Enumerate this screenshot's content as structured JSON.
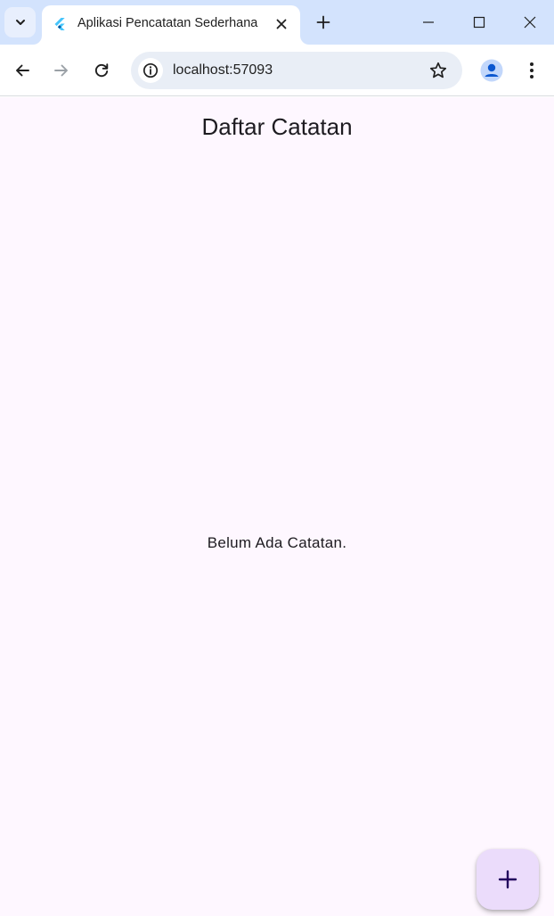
{
  "browser": {
    "tab": {
      "title": "Aplikasi Pencatatan Sederhana",
      "favicon": "flutter-logo-icon"
    },
    "address_bar": {
      "url": "localhost:57093"
    },
    "icons": {
      "tab_search": "chevron-down-icon",
      "tab_close": "close-icon",
      "new_tab": "plus-icon",
      "minimize": "minimize-icon",
      "maximize": "maximize-icon",
      "window_close": "close-icon",
      "back": "arrow-left-icon",
      "forward": "arrow-right-icon",
      "reload": "reload-icon",
      "site_info": "info-icon",
      "bookmark": "star-icon",
      "profile": "person-icon",
      "menu": "more-vertical-icon"
    }
  },
  "app": {
    "title": "Daftar Catatan",
    "empty_message": "Belum Ada Catatan.",
    "fab_icon": "plus-icon"
  },
  "colors": {
    "tabstrip": "#d3e3fd",
    "page_background": "#fef7ff",
    "fab": "#ebdcfb",
    "accent_blue": "#0b57d0"
  }
}
